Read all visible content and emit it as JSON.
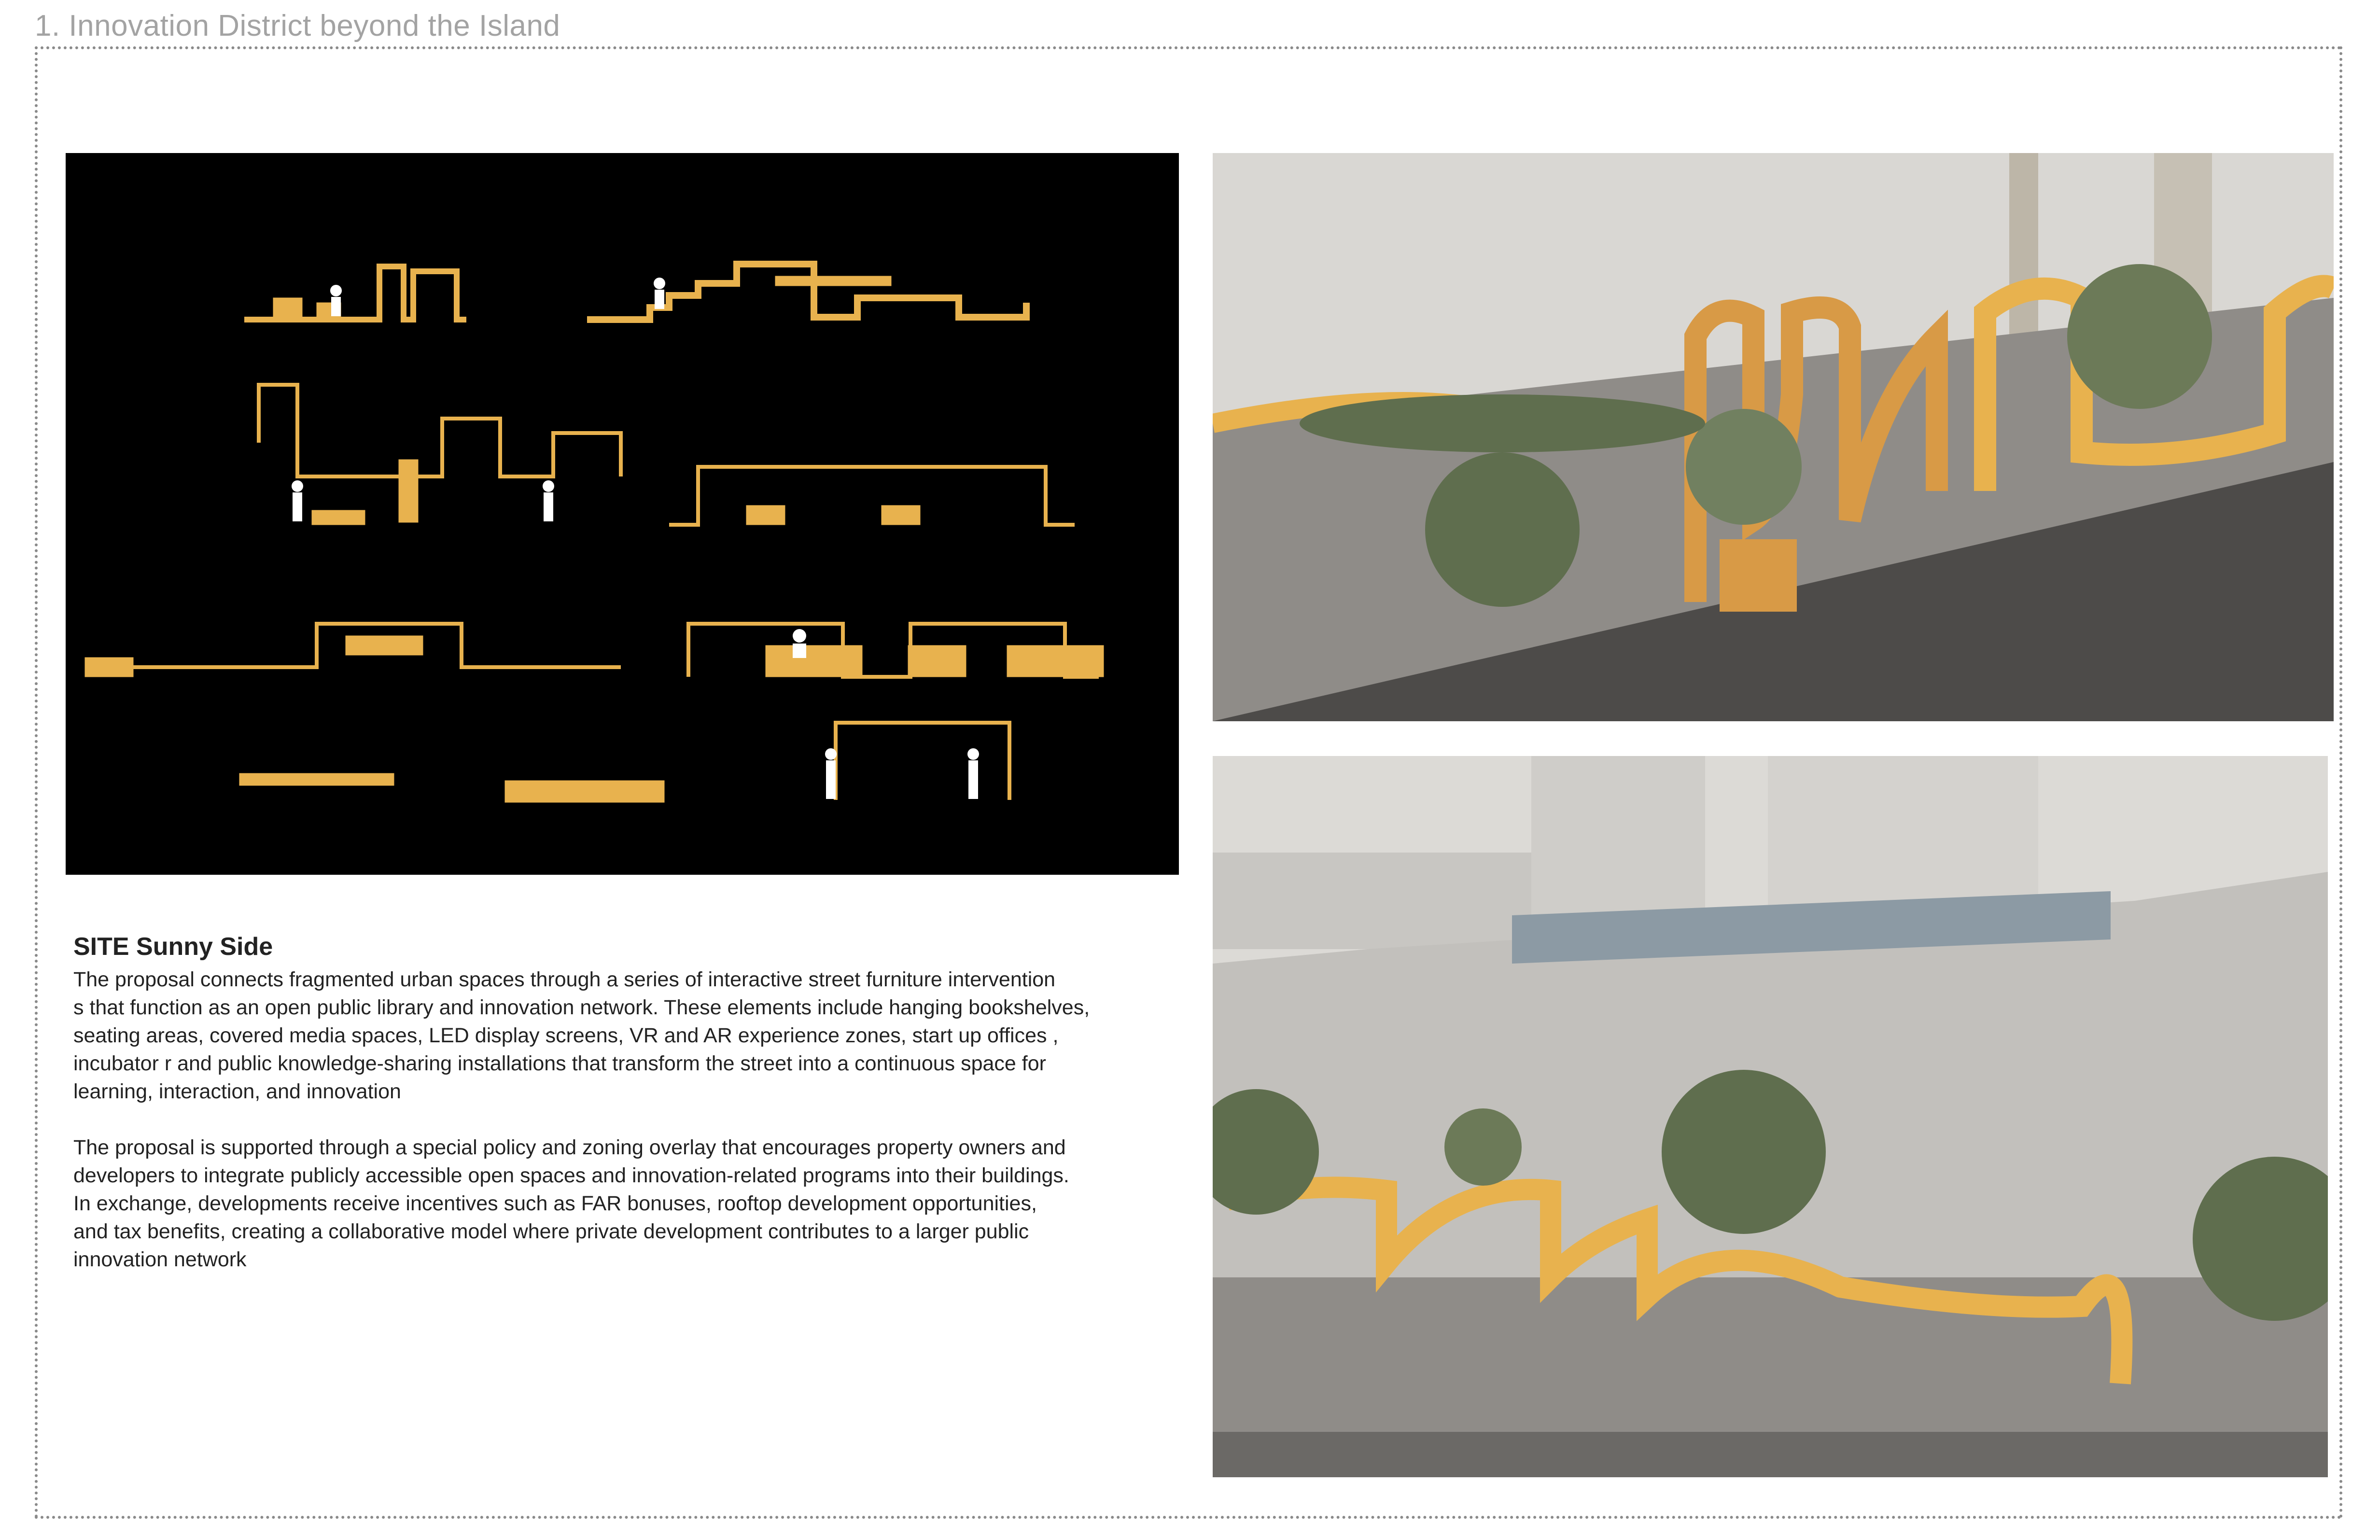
{
  "header": {
    "title": "1. Innovation District beyond the Island"
  },
  "colors": {
    "furniture": "#e8b24e",
    "diagram_background": "#000000",
    "frame_border": "#8a8a8a",
    "sky": "#d9d7d3",
    "road": "#6b6966",
    "foliage": "#5f6e4e"
  },
  "images": {
    "diagrams": "furniture section diagrams on black background",
    "top_render": "street view rendering with continuous yellow bench ribbon",
    "bottom_render": "elevated street view with rooftop terrace"
  },
  "content": {
    "heading": "SITE Sunny Side",
    "paragraph_1": "The proposal connects fragmented urban spaces through a series of interactive street furniture intervention\ns that function as an open public library and innovation network. These elements include hanging bookshelves,\n seating areas, covered media spaces, LED display screens, VR and AR experience zones, start up offices ,\nincubator r and public knowledge-sharing installations that transform the street into a continuous space for\n learning, interaction, and innovation",
    "paragraph_2": "The proposal is supported through a special policy and zoning overlay that encourages property owners and\ndevelopers to integrate publicly accessible open spaces and innovation-related programs into their buildings.\n In exchange, developments receive incentives such as FAR bonuses, rooftop development opportunities,\n and tax benefits, creating a collaborative model where private development contributes to a larger public\ninnovation network"
  }
}
